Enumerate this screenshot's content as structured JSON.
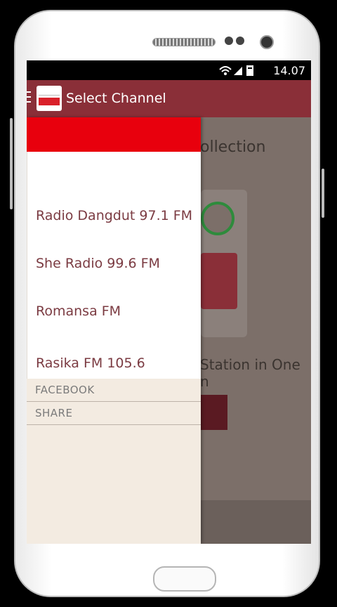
{
  "status": {
    "icons": "wifi signal battery",
    "time": "14.07"
  },
  "actionbar": {
    "title": "Select Channel"
  },
  "background": {
    "heading_fragment": "ollection",
    "desc_line1": "Station in One",
    "desc_line2": "n"
  },
  "drawer": {
    "channels": [
      {
        "label": "Radio Dangdut 97.1 FM"
      },
      {
        "label": "She Radio 99.6 FM"
      },
      {
        "label": "Romansa FM"
      },
      {
        "label": "Rasika FM 105.6"
      }
    ],
    "footer": [
      {
        "label": "FACEBOOK"
      },
      {
        "label": "SHARE"
      }
    ]
  },
  "colors": {
    "actionbar": "#8a2f38",
    "drawer_header": "#e8000d",
    "item_text": "#7b3b42"
  }
}
